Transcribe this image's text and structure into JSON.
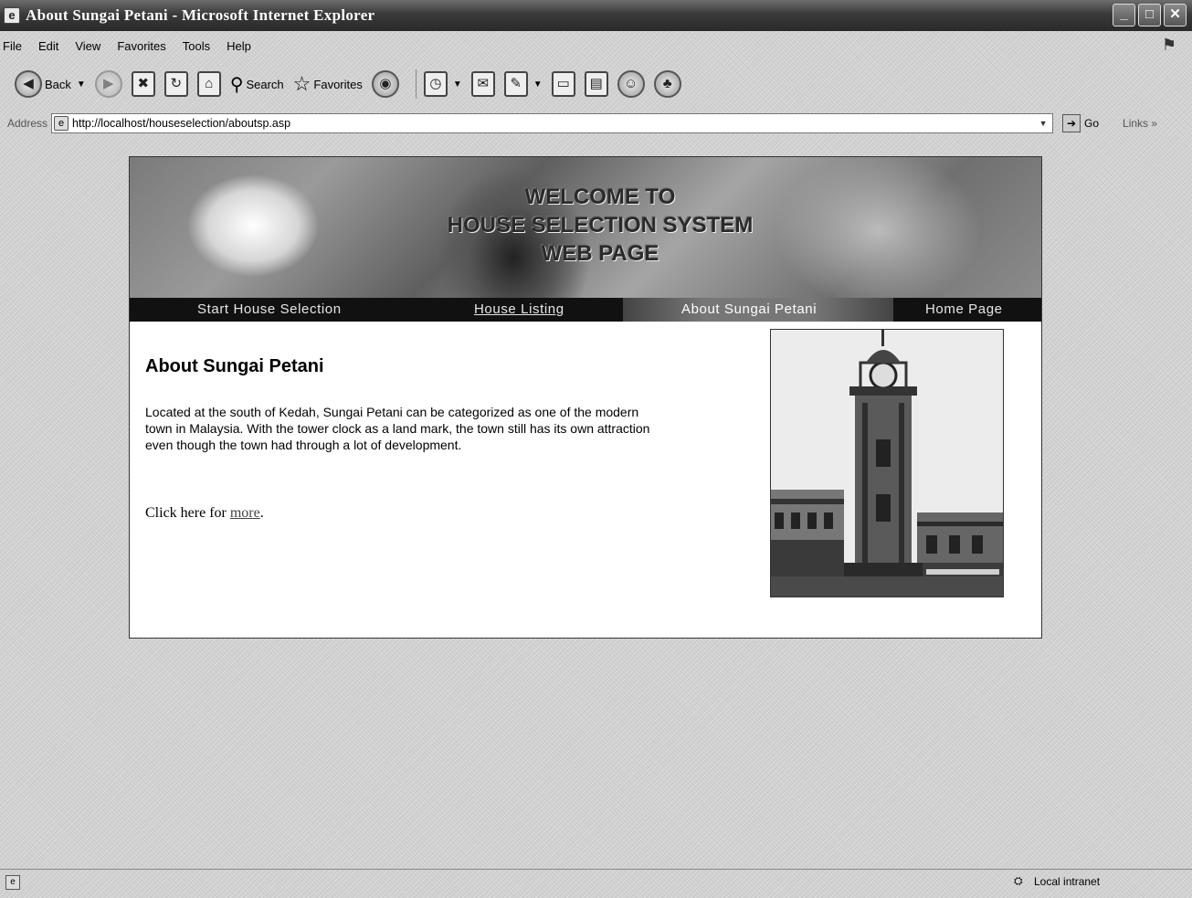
{
  "window": {
    "title": "About Sungai Petani - Microsoft Internet Explorer",
    "buttons": {
      "minimize": "_",
      "maximize": "□",
      "close": "✕"
    }
  },
  "menu": [
    "File",
    "Edit",
    "View",
    "Favorites",
    "Tools",
    "Help"
  ],
  "toolbar": {
    "back_label": "Back",
    "search_label": "Search",
    "favorites_label": "Favorites"
  },
  "address": {
    "label": "Address",
    "url": "http://localhost/houseselection/aboutsp.asp",
    "go_label": "Go",
    "links_label": "Links"
  },
  "banner": {
    "lines": [
      "WELCOME TO",
      "HOUSE SELECTION SYSTEM",
      "WEB PAGE"
    ]
  },
  "nav": [
    {
      "label": "Start House Selection"
    },
    {
      "label": "House Listing"
    },
    {
      "label": "About Sungai Petani"
    },
    {
      "label": "Home Page"
    }
  ],
  "content": {
    "heading": "About Sungai Petani",
    "paragraph": "Located at the south of Kedah, Sungai Petani can be categorized as one of the modern town in Malaysia. With the tower clock as a land mark, the town still has its own attraction even though the town had through a lot of development.",
    "click_prefix": "Click here for ",
    "more_link": "more",
    "click_suffix": "."
  },
  "status": {
    "zone": "Local intranet"
  }
}
